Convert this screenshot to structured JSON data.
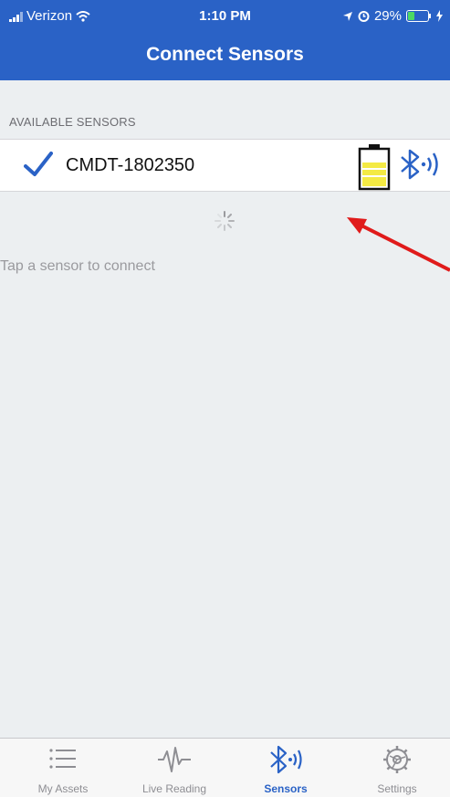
{
  "status_bar": {
    "carrier": "Verizon",
    "time": "1:10 PM",
    "battery_percent": "29%",
    "icons": [
      "signal-icon",
      "wifi-icon",
      "location-icon",
      "alarm-icon",
      "battery-icon",
      "charging-icon"
    ]
  },
  "nav": {
    "title": "Connect Sensors"
  },
  "section": {
    "header": "AVAILABLE SENSORS"
  },
  "sensors": [
    {
      "name": "CMDT-1802350",
      "selected": true,
      "battery_level": 0.6,
      "icons": [
        "checkmark-icon",
        "battery-icon",
        "bluetooth-icon"
      ]
    }
  ],
  "hint": "Tap a sensor to connect",
  "tabs": [
    {
      "label": "My Assets",
      "icon": "list-icon",
      "active": false
    },
    {
      "label": "Live Reading",
      "icon": "waveform-icon",
      "active": false
    },
    {
      "label": "Sensors",
      "icon": "bluetooth-icon",
      "active": true
    },
    {
      "label": "Settings",
      "icon": "gear-icon",
      "active": false
    }
  ],
  "colors": {
    "accent": "#2a62c6",
    "battery_fill": "#f4ea44",
    "annotation_arrow": "#e01b1b"
  }
}
